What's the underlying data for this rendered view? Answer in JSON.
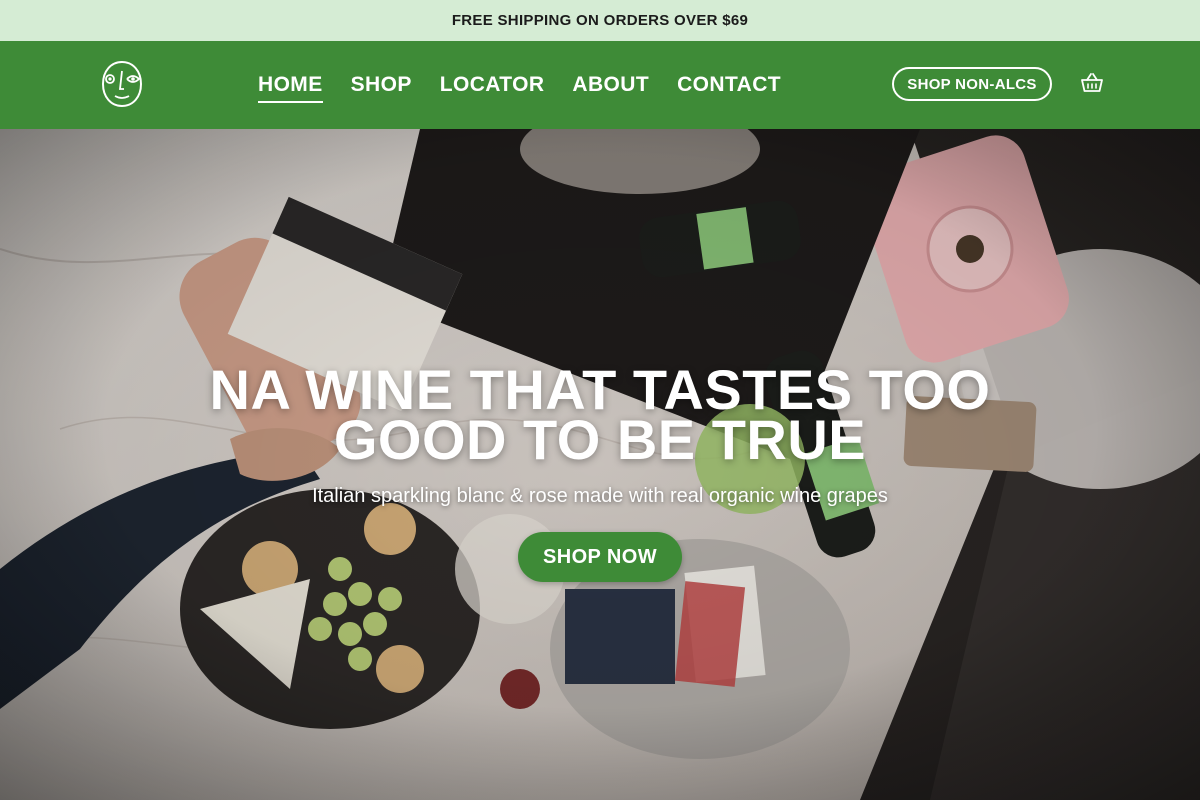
{
  "announcement": {
    "text": "FREE SHIPPING ON ORDERS OVER $69"
  },
  "header": {
    "logo": "face-logo-icon",
    "nav": [
      {
        "label": "HOME",
        "active": true
      },
      {
        "label": "SHOP",
        "active": false
      },
      {
        "label": "LOCATOR",
        "active": false
      },
      {
        "label": "ABOUT",
        "active": false
      },
      {
        "label": "CONTACT",
        "active": false
      }
    ],
    "shop_button": "SHOP NON-ALCS",
    "cart_icon": "basket-icon"
  },
  "hero": {
    "headline": "NA WINE THAT TASTES TOO GOOD TO BE TRUE",
    "subheadline": "Italian sparkling blanc & rose made with real organic wine grapes",
    "cta": "SHOP NOW"
  },
  "colors": {
    "announcement_bg": "#d5ecd4",
    "brand_green": "#3e8b37",
    "text_light": "#ffffff"
  }
}
